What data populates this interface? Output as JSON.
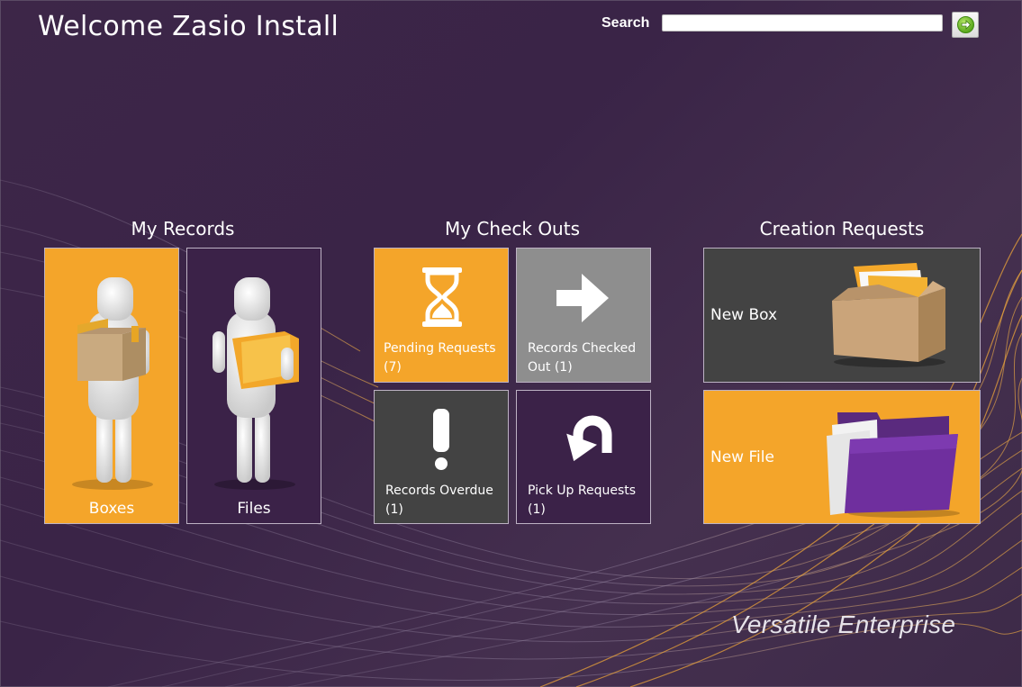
{
  "header": {
    "welcome": "Welcome Zasio Install",
    "search_label": "Search",
    "search_value": "",
    "search_go_icon": "green-arrow-go-icon"
  },
  "sections": {
    "my_records": {
      "title": "My Records",
      "tiles": [
        {
          "label": "Boxes",
          "icon": "person-holding-box-icon",
          "color": "#f4a52a"
        },
        {
          "label": "Files",
          "icon": "person-holding-folder-icon",
          "color": "#3b2248"
        }
      ]
    },
    "my_checkouts": {
      "title": "My Check Outs",
      "tiles": [
        {
          "label": "Pending Requests",
          "count": "(7)",
          "icon": "hourglass-icon",
          "color": "#f4a52a"
        },
        {
          "label": "Records Checked",
          "label2": "Out (1)",
          "icon": "arrow-right-icon",
          "color": "#8e8e8e"
        },
        {
          "label": "Records Overdue",
          "count": "(1)",
          "icon": "exclamation-icon",
          "color": "#434343"
        },
        {
          "label": "Pick Up Requests",
          "count": "(1)",
          "icon": "u-turn-arrow-icon",
          "color": "#3b2248"
        }
      ]
    },
    "creation_requests": {
      "title": "Creation Requests",
      "tiles": [
        {
          "label": "New Box",
          "icon": "cardboard-box-icon",
          "color": "#434343"
        },
        {
          "label": "New File",
          "icon": "purple-folder-icon",
          "color": "#f4a52a"
        }
      ]
    }
  },
  "footer": {
    "brand": "Versatile Enterprise"
  }
}
